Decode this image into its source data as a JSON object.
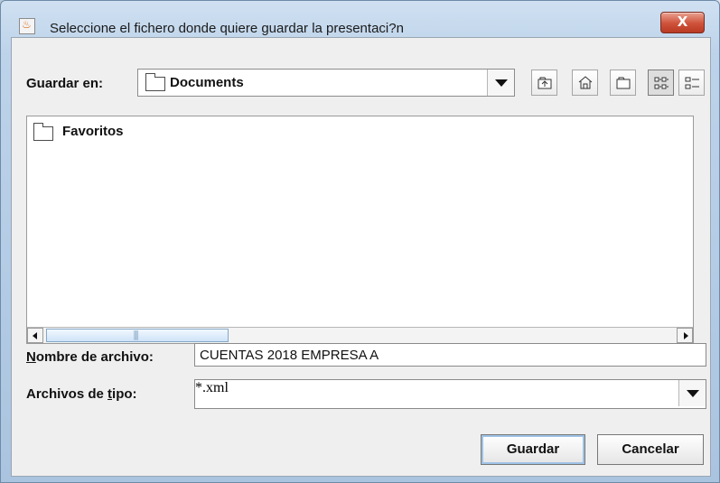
{
  "window": {
    "title": "Seleccione el fichero donde quiere guardar la presentaci?n",
    "close_label": "X"
  },
  "toolbar": {
    "save_in_label": "Guardar en:",
    "save_in_value": "Documents"
  },
  "file_list": {
    "items": [
      {
        "label": "Favoritos"
      }
    ]
  },
  "form": {
    "file_name_label_prefix": "N",
    "file_name_label_rest": "ombre de archivo:",
    "file_name_value": "CUENTAS 2018 EMPRESA A",
    "file_type_label_prefix": "Archivos de ",
    "file_type_label_mnemonic": "t",
    "file_type_label_rest": "ipo:",
    "file_type_value": "*.xml"
  },
  "buttons": {
    "save": "Guardar",
    "cancel": "Cancelar"
  },
  "icons": {
    "app": "java-icon",
    "folder": "folder-icon",
    "up_folder": "up-folder-icon",
    "home": "home-icon",
    "new_folder": "new-folder-icon",
    "list_view": "list-view-icon",
    "details_view": "details-view-icon"
  }
}
